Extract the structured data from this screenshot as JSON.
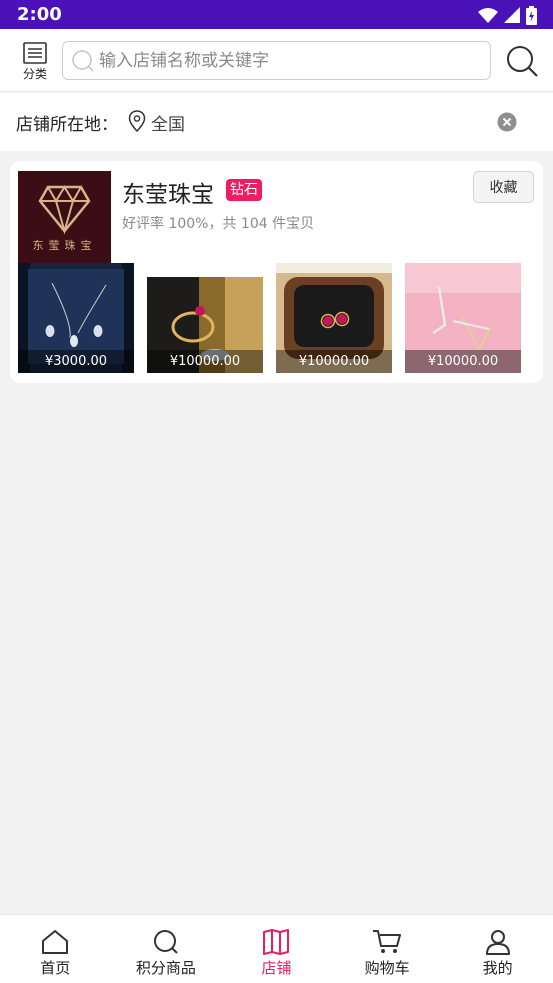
{
  "status_bar": {
    "time": "2:00"
  },
  "header": {
    "category_label": "分类",
    "search_placeholder": "输入店铺名称或关键字"
  },
  "location": {
    "label": "店铺所在地：",
    "value": "全国"
  },
  "shop": {
    "logo_text": "东莹珠宝",
    "name": "东莹珠宝",
    "badge": "钻石",
    "stats": "好评率 100%，共 104 件宝贝",
    "favorite_label": "收藏",
    "products": [
      {
        "price": "¥3000.00",
        "image": "necklace"
      },
      {
        "price": "¥10000.00",
        "image": "ruby-ring"
      },
      {
        "price": "¥10000.00",
        "image": "ruby-earrings"
      },
      {
        "price": "¥10000.00",
        "image": "silver-rings"
      }
    ]
  },
  "tabs": [
    {
      "label": "首页",
      "icon": "home-icon",
      "active": false
    },
    {
      "label": "积分商品",
      "icon": "search-icon",
      "active": false
    },
    {
      "label": "店铺",
      "icon": "shop-book-icon",
      "active": true
    },
    {
      "label": "购物车",
      "icon": "cart-icon",
      "active": false
    },
    {
      "label": "我的",
      "icon": "user-icon",
      "active": false
    }
  ],
  "colors": {
    "status_bar": "#4a12b8",
    "accent": "#e91e63"
  }
}
